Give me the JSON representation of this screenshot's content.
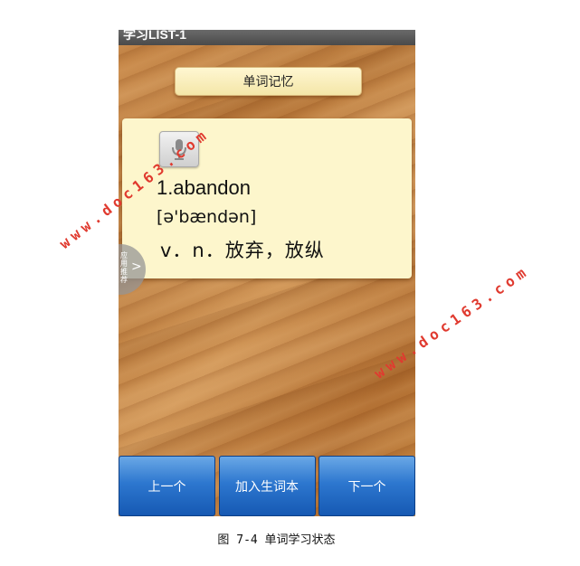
{
  "window": {
    "title": "学习LIST-1"
  },
  "header": {
    "mode_label": "单词记忆"
  },
  "card": {
    "speak_icon": "microphone-icon",
    "word": "1.abandon",
    "phonetic": "[ə'bændən]",
    "meaning": "v．n．放弃，放纵"
  },
  "side_tab": {
    "label": "应用推荐",
    "arrow": ">"
  },
  "nav": {
    "prev": "上一个",
    "add": "加入生词本",
    "next": "下一个"
  },
  "watermarks": [
    "www.doc163.com",
    "www.doc163.com"
  ],
  "caption": "图 7-4  单词学习状态",
  "colors": {
    "card_bg": "#fdf6cc",
    "button_blue": "#2d77cf",
    "watermark_red": "#e03a2f"
  }
}
